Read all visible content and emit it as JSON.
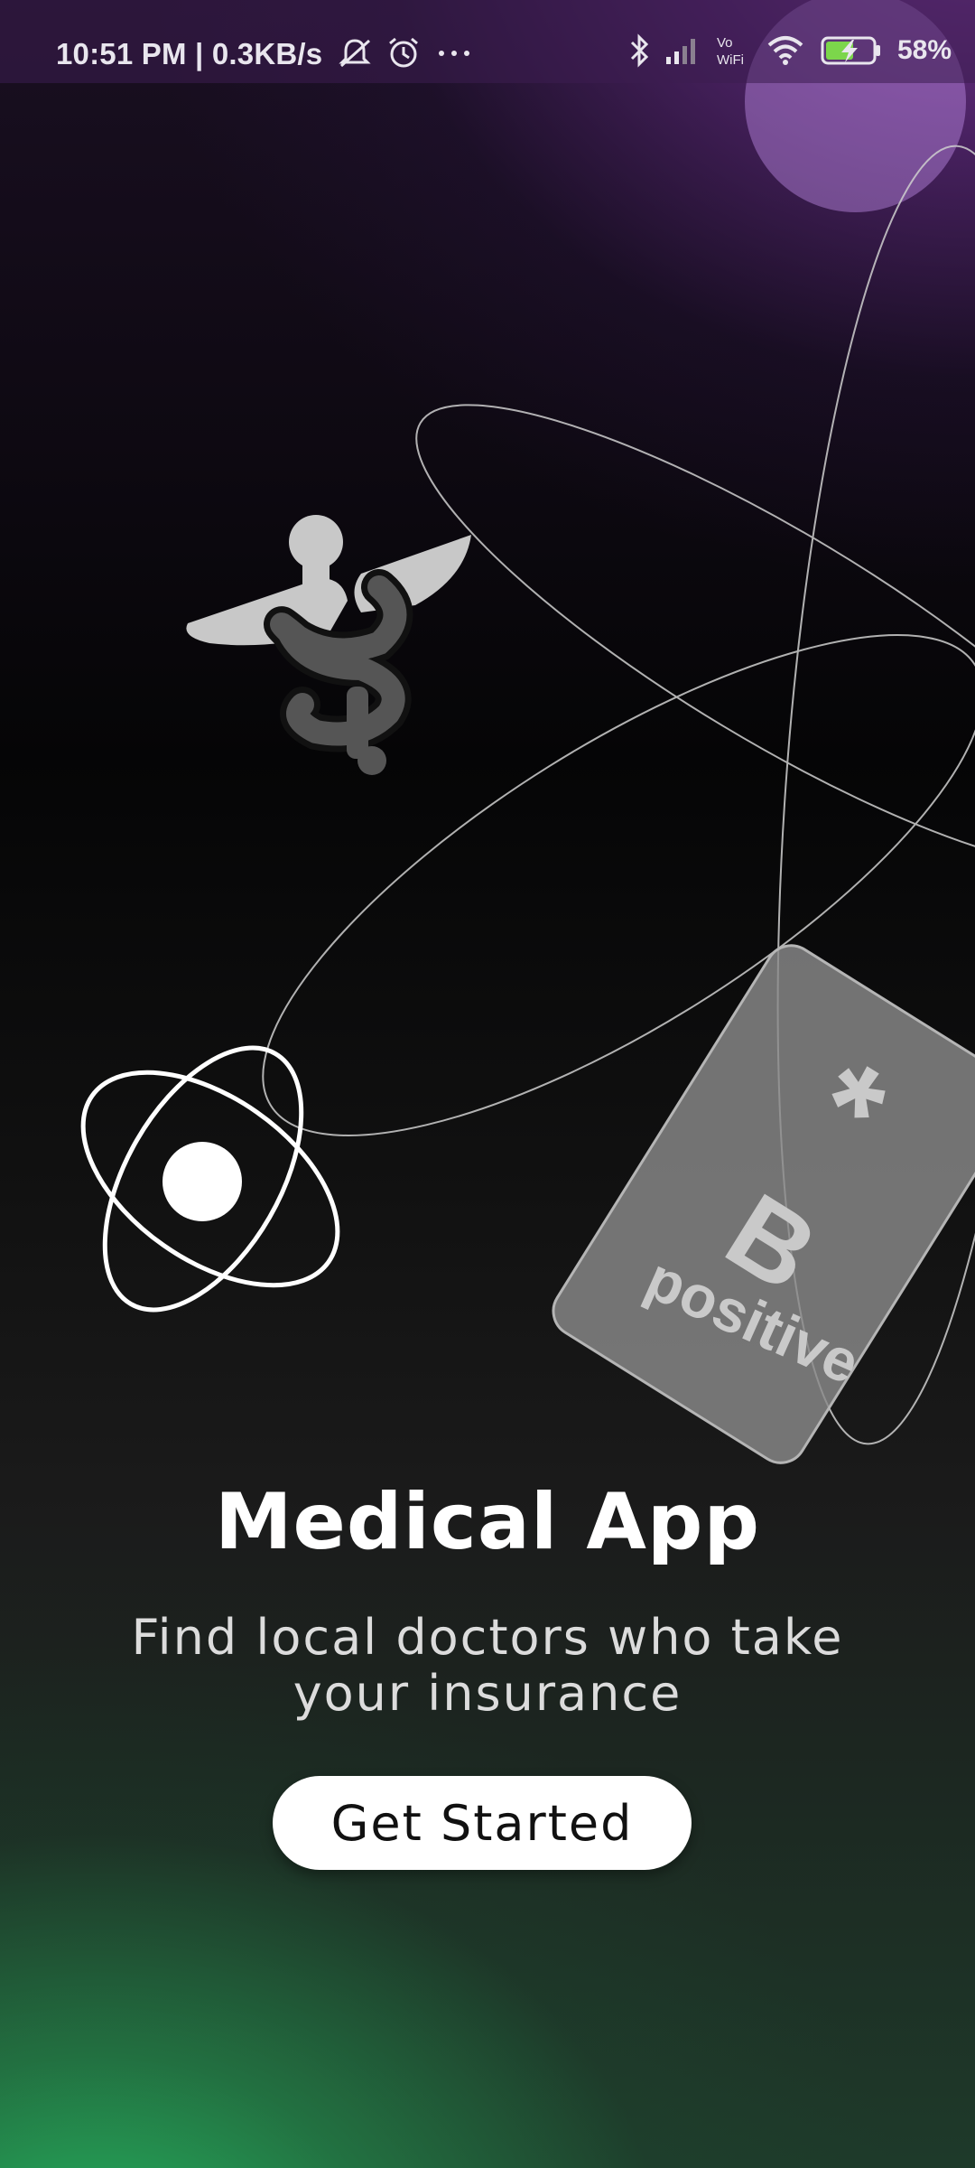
{
  "status_bar": {
    "time_and_speed": "10:51 PM | 0.3KB/s",
    "battery_percent": "58%",
    "network_label": "Vo\nWiFi",
    "icons": [
      "mute-notifications-icon",
      "alarm-icon",
      "more-dots-icon",
      "bluetooth-icon",
      "signal-icon",
      "vowifi-icon",
      "wifi-icon",
      "battery-charging-icon"
    ]
  },
  "hero": {
    "card_symbol": "*",
    "card_letter": "B",
    "card_word": "positive",
    "icons": [
      "caduceus-icon",
      "atom-icon",
      "blood-type-card"
    ]
  },
  "main": {
    "title": "Medical App",
    "subtitle": "Find local doctors who take your insurance",
    "cta_label": "Get Started"
  },
  "colors": {
    "accent_purple": "#823ca0",
    "accent_green": "#26be64",
    "button_bg": "#ffffff"
  }
}
